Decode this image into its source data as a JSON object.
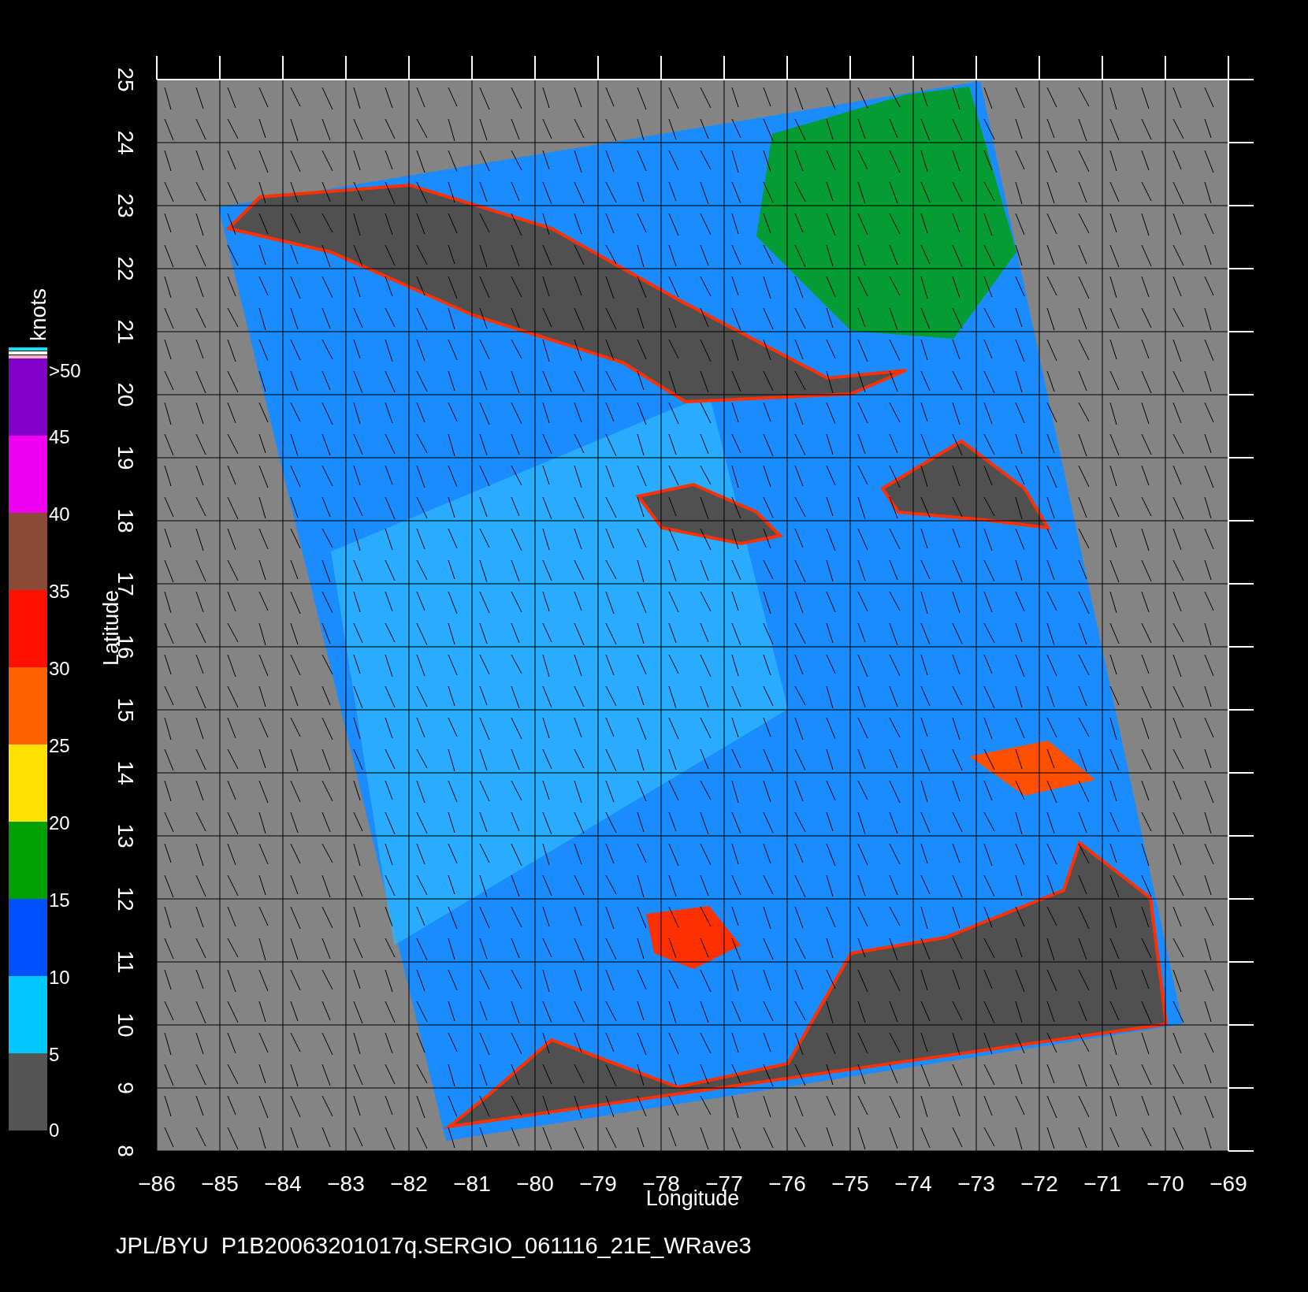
{
  "plot": {
    "x_axis": {
      "label": "Longitude",
      "ticks": [
        "−86",
        "−85",
        "−84",
        "−83",
        "−82",
        "−81",
        "−80",
        "−79",
        "−78",
        "−77",
        "−76",
        "−75",
        "−74",
        "−73",
        "−72",
        "−71",
        "−70",
        "−69"
      ]
    },
    "y_axis": {
      "label": "Latitude",
      "ticks": [
        "8",
        "9",
        "10",
        "11",
        "12",
        "13",
        "14",
        "15",
        "16",
        "17",
        "18",
        "19",
        "20",
        "21",
        "22",
        "23",
        "24",
        "25"
      ]
    }
  },
  "colorbar": {
    "title": "knots",
    "labels": [
      ">50",
      "45",
      "40",
      "35",
      "30",
      "25",
      "20",
      "15",
      "10",
      "5",
      "0"
    ],
    "bands": [
      {
        "color": "#8000c8"
      },
      {
        "color": "#f000f0"
      },
      {
        "color": "#8a4a36"
      },
      {
        "color": "#ff1000"
      },
      {
        "color": "#ff6000"
      },
      {
        "color": "#ffe000"
      },
      {
        "color": "#00a000"
      },
      {
        "color": "#0050ff"
      },
      {
        "color": "#00c8ff"
      },
      {
        "color": "#555555"
      }
    ]
  },
  "caption": "JPL/BYU  P1B20063201017q.SERGIO_061116_21E_WRave3"
}
